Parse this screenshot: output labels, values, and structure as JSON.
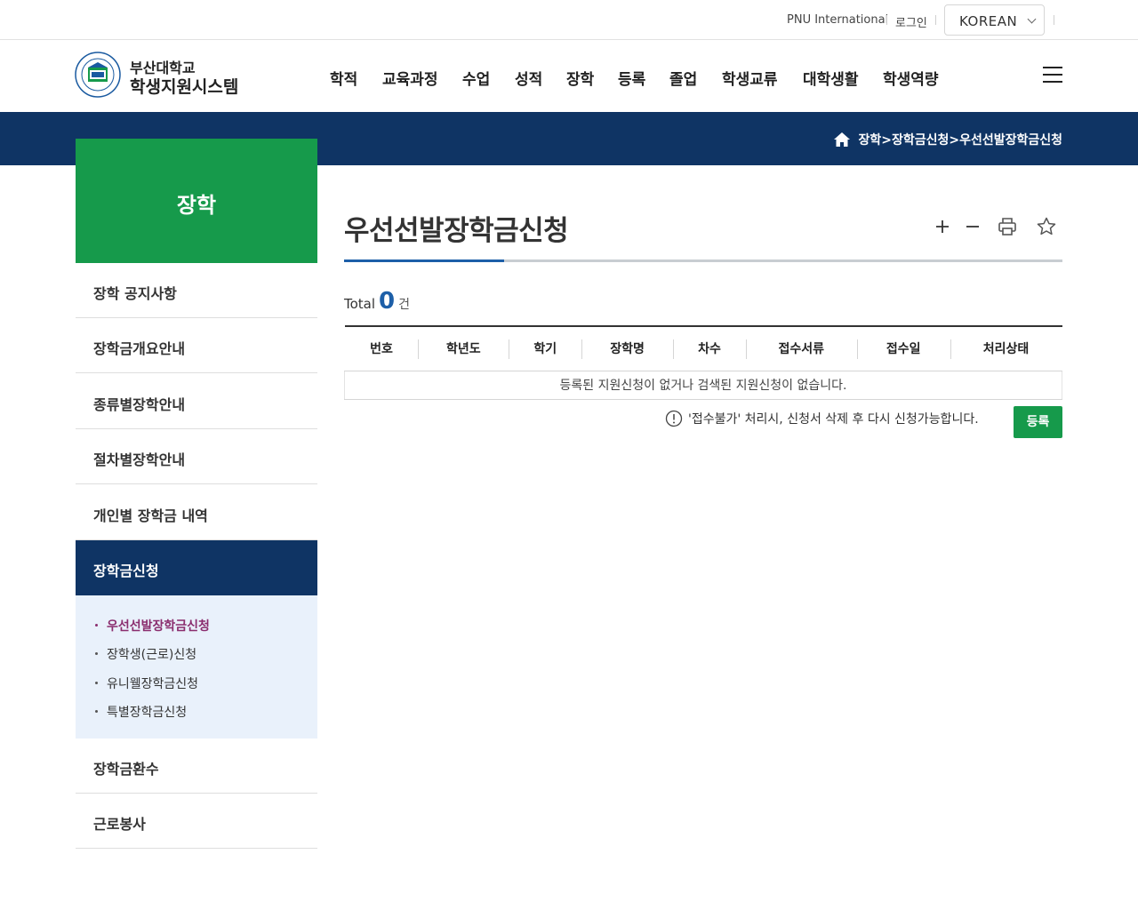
{
  "util": {
    "international": "PNU International",
    "login": "로그인",
    "language": "KOREAN"
  },
  "header": {
    "logo_line1": "부산대학교",
    "logo_line2": "학생지원시스템",
    "nav": [
      "학적",
      "교육과정",
      "수업",
      "성적",
      "장학",
      "등록",
      "졸업",
      "학생교류",
      "대학생활",
      "학생역량"
    ]
  },
  "breadcrumb": {
    "text": "장학>장학금신청>우선선발장학금신청"
  },
  "sidebar": {
    "title": "장학",
    "items": [
      {
        "label": "장학 공지사항"
      },
      {
        "label": "장학금개요안내"
      },
      {
        "label": "종류별장학안내"
      },
      {
        "label": "절차별장학안내"
      },
      {
        "label": "개인별 장학금 내역"
      },
      {
        "label": "장학금신청"
      },
      {
        "label": "장학금환수"
      },
      {
        "label": "근로봉사"
      }
    ],
    "sub_items": [
      {
        "label": "우선선발장학금신청"
      },
      {
        "label": "장학생(근로)신청"
      },
      {
        "label": "유니웰장학금신청"
      },
      {
        "label": "특별장학금신청"
      }
    ]
  },
  "main": {
    "title": "우선선발장학금신청",
    "total_label": "Total",
    "total_count": "0",
    "total_unit": "건",
    "columns": [
      "번호",
      "학년도",
      "학기",
      "장학명",
      "차수",
      "접수서류",
      "접수일",
      "처리상태"
    ],
    "empty_message": "등록된 지원신청이 없거나 검색된 지원신청이 없습니다.",
    "notice": "'접수불가' 처리시, 신청서 삭제 후 다시 신청가능합니다.",
    "register_button": "등록"
  },
  "colors": {
    "navy": "#0f3464",
    "green": "#169a4b",
    "accent_blue": "#1d5fa8",
    "current_sub": "#8a2d6e"
  }
}
